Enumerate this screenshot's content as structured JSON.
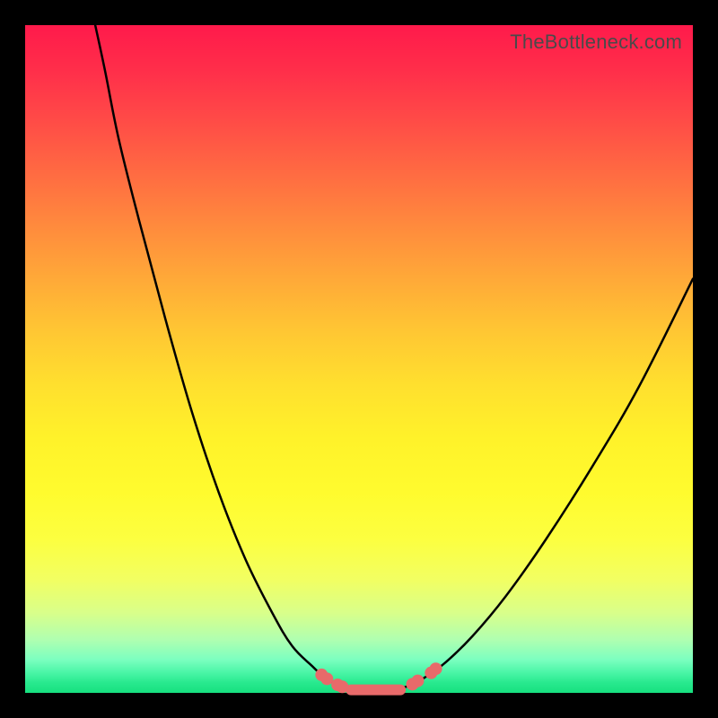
{
  "watermark": "TheBottleneck.com",
  "colors": {
    "frame": "#000000",
    "curve": "#000000",
    "marker": "#e86a6a",
    "gradient_top": "#ff1a4b",
    "gradient_bottom": "#17e07f"
  },
  "chart_data": {
    "type": "line",
    "title": "",
    "xlabel": "",
    "ylabel": "",
    "xlim": [
      0,
      100
    ],
    "ylim": [
      0,
      100
    ],
    "grid": false,
    "legend": false,
    "annotations": [
      "TheBottleneck.com"
    ],
    "series": [
      {
        "name": "left-branch",
        "x": [
          10.5,
          12,
          14,
          17,
          21,
          25,
          29,
          33,
          37,
          40,
          43,
          44.5,
          46,
          47.5
        ],
        "y": [
          100,
          93,
          83,
          71,
          56,
          42,
          30,
          20,
          12,
          7,
          4,
          2.6,
          1.6,
          0.9
        ]
      },
      {
        "name": "valley",
        "x": [
          47.5,
          49,
          51,
          53,
          55,
          57,
          58.5
        ],
        "y": [
          0.9,
          0.5,
          0.35,
          0.35,
          0.5,
          0.9,
          1.5
        ]
      },
      {
        "name": "right-branch",
        "x": [
          58.5,
          60,
          63,
          67,
          72,
          78,
          85,
          92,
          100
        ],
        "y": [
          1.5,
          2.4,
          4.6,
          8.5,
          14.5,
          23,
          34,
          46,
          62
        ]
      }
    ],
    "markers": [
      {
        "x": 44.4,
        "y": 2.7
      },
      {
        "x": 45.2,
        "y": 2.1
      },
      {
        "x": 46.8,
        "y": 1.2
      },
      {
        "x": 47.5,
        "y": 0.9
      },
      {
        "x": 58.0,
        "y": 1.3
      },
      {
        "x": 58.8,
        "y": 1.8
      },
      {
        "x": 60.8,
        "y": 3.0
      },
      {
        "x": 61.5,
        "y": 3.6
      }
    ],
    "valley_pill": {
      "x0": 48.0,
      "x1": 57.0,
      "y": 0.45
    }
  }
}
